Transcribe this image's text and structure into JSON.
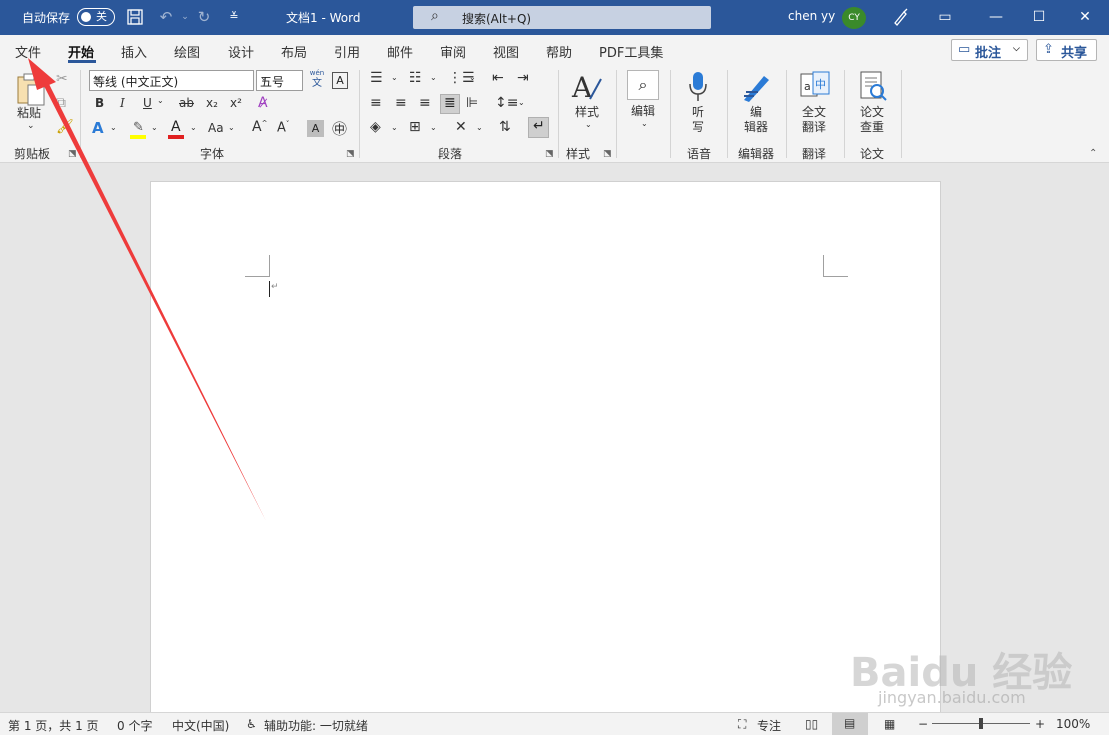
{
  "titlebar": {
    "autosave_label": "自动保存",
    "autosave_state": "关",
    "doc_title": "文档1  -  Word",
    "search_placeholder": "搜索(Alt+Q)",
    "user_name": "chen yy",
    "avatar_initials": "CY"
  },
  "tabs": [
    "文件",
    "开始",
    "插入",
    "绘图",
    "设计",
    "布局",
    "引用",
    "邮件",
    "审阅",
    "视图",
    "帮助",
    "PDF工具集"
  ],
  "active_tab": "开始",
  "tab_actions": {
    "comments": "批注",
    "share": "共享"
  },
  "ribbon": {
    "clipboard": {
      "paste": "粘贴",
      "group_label": "剪贴板"
    },
    "font": {
      "font_name": "等线 (中文正文)",
      "font_size": "五号",
      "wen": "wén",
      "wen_char": "文",
      "big_a": "A",
      "bold": "B",
      "italic": "I",
      "underline": "U",
      "strike": "ab",
      "sub": "x₂",
      "sup": "x²",
      "aa": "Aa",
      "grow": "A^",
      "shrink": "A˅",
      "group_label": "字体"
    },
    "paragraph": {
      "group_label": "段落"
    },
    "styles": {
      "label": "样式",
      "group_label": "样式"
    },
    "editing": {
      "label": "编辑"
    },
    "voice": {
      "label_1": "听",
      "label_2": "写",
      "group_label": "语音"
    },
    "editor": {
      "label_1": "编",
      "label_2": "辑器",
      "group_label": "编辑器"
    },
    "translate": {
      "label_1": "全文",
      "label_2": "翻译",
      "group_label": "翻译"
    },
    "paper": {
      "label_1": "论文",
      "label_2": "查重",
      "group_label": "论文"
    }
  },
  "statusbar": {
    "page": "第 1 页，共 1 页",
    "words": "0 个字",
    "language": "中文(中国)",
    "accessibility": "辅助功能: 一切就绪",
    "focus": "专注",
    "zoom": "100%",
    "zoom_level": 100
  },
  "watermark": {
    "brand": "Baidu 经验",
    "url": "jingyan.baidu.com"
  },
  "colors": {
    "titlebar": "#2b579a",
    "arrow": "#ee3b3b",
    "highlight": "#ffff00",
    "font_color": "#e02020"
  }
}
